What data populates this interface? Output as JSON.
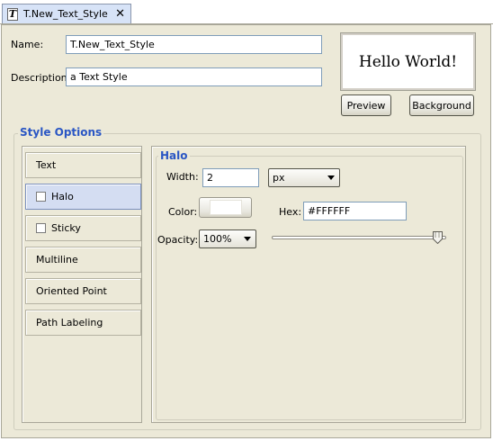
{
  "tab": {
    "title": "T.New_Text_Style",
    "icon": "text-style-icon",
    "close": "✕"
  },
  "form": {
    "name_label": "Name:",
    "name_value": "T.New_Text_Style",
    "description_label": "Description:",
    "description_value": "a Text Style"
  },
  "preview": {
    "text": "Hello World!",
    "preview_button": "Preview",
    "background_button": "Background"
  },
  "style_options": {
    "title": "Style Options",
    "items": [
      {
        "label": "Text",
        "checkbox": false,
        "selected": false
      },
      {
        "label": "Halo",
        "checkbox": true,
        "selected": true
      },
      {
        "label": "Sticky",
        "checkbox": true,
        "selected": false
      },
      {
        "label": "Multiline",
        "checkbox": false,
        "selected": false
      },
      {
        "label": "Oriented Point",
        "checkbox": false,
        "selected": false
      },
      {
        "label": "Path Labeling",
        "checkbox": false,
        "selected": false
      }
    ]
  },
  "halo": {
    "title": "Halo",
    "width_label": "Width:",
    "width_value": "2",
    "unit_value": "px",
    "color_label": "Color:",
    "color_swatch": "#FFFFFF",
    "hex_label": "Hex:",
    "hex_value": "#FFFFFF",
    "opacity_label": "Opacity:",
    "opacity_value": "100%",
    "opacity_fraction": 1.0
  },
  "colors": {
    "accent": "#2A56C4",
    "panel": "#ECE9D8",
    "selected": "#D4DDF2"
  }
}
